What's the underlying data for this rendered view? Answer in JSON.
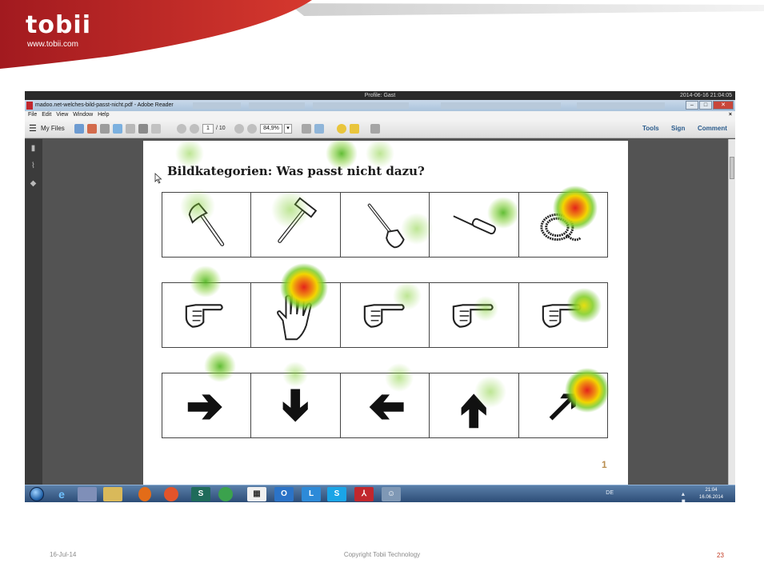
{
  "slide": {
    "brand": "tobii",
    "brand_url": "www.tobii.com",
    "footer_date": "16-Jul-14",
    "footer_copyright": "Copyright Tobii Technology",
    "slide_number": "23"
  },
  "screen": {
    "profile_label": "Profile: Gast",
    "timestamp": "2014-06-16 21:04:05",
    "window_title": "madoo.net-welches-bild-passt-nicht.pdf - Adobe Reader",
    "menu": [
      "File",
      "Edit",
      "View",
      "Window",
      "Help"
    ],
    "toolbar": {
      "my_files": "My Files",
      "page_current": "1",
      "page_total": "/ 10",
      "zoom": "84,9%",
      "tools": "Tools",
      "sign": "Sign",
      "comment": "Comment"
    },
    "pdf": {
      "title": "Bildkategorien: Was passt nicht dazu?",
      "page_number": "1",
      "rows": [
        [
          "axe-icon",
          "hammer-icon",
          "shovel-icon",
          "screwdriver-icon",
          "rope-icon"
        ],
        [
          "pointing-hand-icon",
          "open-hand-icon",
          "pointing-hand-icon",
          "pointing-hand-icon",
          "pointing-hand-icon"
        ],
        [
          "arrow-right-icon",
          "arrow-down-icon",
          "arrow-left-icon",
          "arrow-up-icon",
          "arrow-diagonal-icon"
        ]
      ]
    },
    "taskbar": {
      "language": "DE",
      "clock_time": "21:04",
      "clock_date": "16.06.2014",
      "apps": [
        "internet-explorer",
        "paint",
        "explorer",
        "media-player",
        "firefox",
        "sway",
        "green-app",
        "calculator",
        "outlook",
        "lync",
        "skype",
        "acrobat",
        "chat"
      ]
    }
  },
  "colors": {
    "brand_red": "#c1272d",
    "heat_hot": "#e4231b",
    "heat_warm": "#f2d600",
    "heat_cool": "#6cc12a"
  }
}
